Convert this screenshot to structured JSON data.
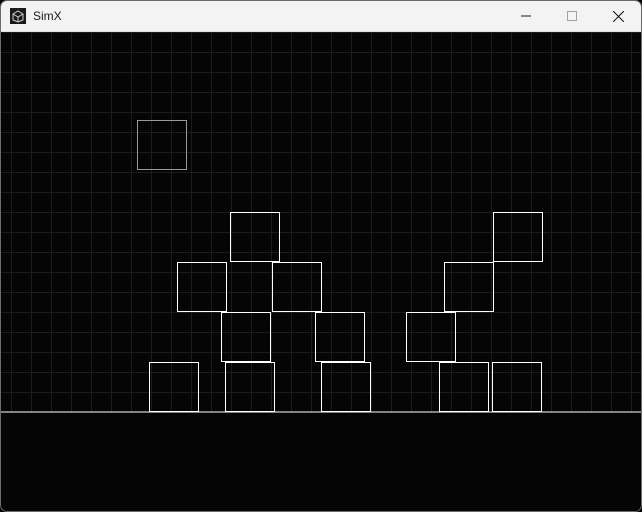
{
  "window": {
    "title": "SimX"
  },
  "titlebar": {
    "icon": "simx-app-icon",
    "controls": [
      "minimize-icon",
      "maximize-icon",
      "close-icon"
    ]
  },
  "colors": {
    "background": "#000000",
    "grid": "#1c1c1c",
    "ground": "#ffffff",
    "box": "#ffffff",
    "ghost_box": "#9a9a9a",
    "titlebar": "#f3f3f3"
  }
}
